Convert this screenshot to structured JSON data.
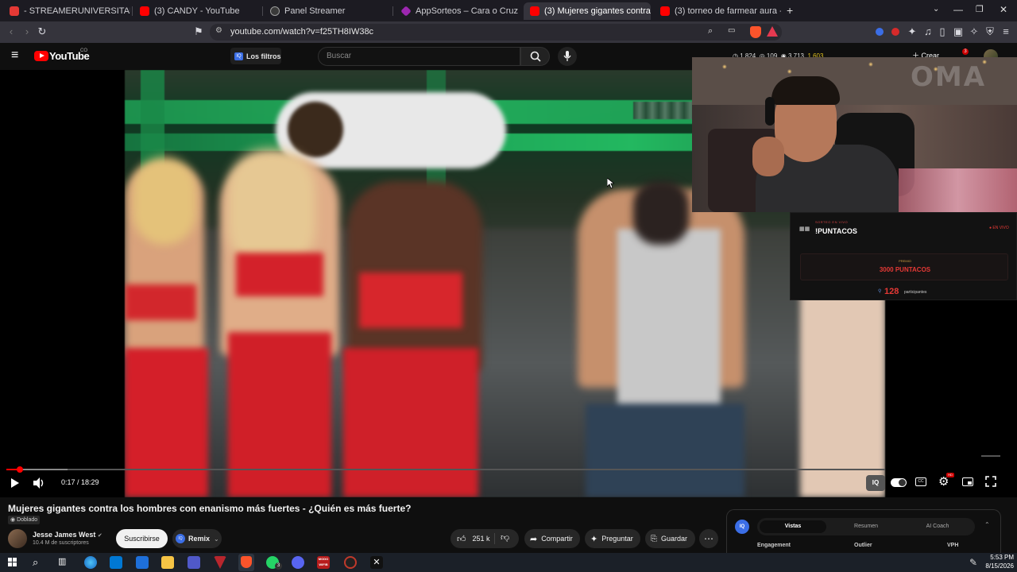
{
  "browser": {
    "tabs": [
      {
        "title": "- STREAMERUNIVERSITARIO - CANJE",
        "color": "#e53935"
      },
      {
        "title": "(3) CANDY - YouTube",
        "color": "#ff0000"
      },
      {
        "title": "Panel Streamer",
        "color": "#9e9e9e"
      },
      {
        "title": "AppSorteos – Cara o Cruz - Tirar una",
        "color": "#9c27b0"
      },
      {
        "title": "(3) Mujeres gigantes contra los h",
        "color": "#ff0000"
      },
      {
        "title": "(3) torneo de farmear aura - YouTube",
        "color": "#ff0000"
      }
    ],
    "new_tab": "+",
    "url": "youtube.com/watch?v=f25TH8IW38c"
  },
  "youtube": {
    "logo": "YouTube",
    "country": "CO",
    "filters_label": "Los filtros",
    "search_placeholder": "Buscar",
    "stats": [
      "1.824",
      "109",
      "3.713",
      "1.603"
    ],
    "create_label": "Crear",
    "notif_count": "3"
  },
  "player": {
    "time": "0:17 / 18:29",
    "progress": 0.015,
    "buffered": 0.07,
    "hd_badge": "HD"
  },
  "raffle": {
    "header": "SORTEO EN VIVO",
    "title": "!PUNTACOS",
    "live": "EN VIVO",
    "prize_label": "PREMIO",
    "prize": "3000 PUNTACOS",
    "count": "128",
    "count_label": "participantes"
  },
  "webcam": {
    "overlay_text": "OMA"
  },
  "video": {
    "title": "Mujeres gigantes contra los hombres con enanismo más fuertes - ¿Quién es más fuerte?",
    "dubbed": "Doblado",
    "channel": "Jesse James West",
    "subscribers": "10.4 M de suscriptores",
    "subscribe": "Suscribirse",
    "remix": "Remix",
    "likes": "251 k",
    "share": "Compartir",
    "ask": "Preguntar",
    "save": "Guardar"
  },
  "side_panel": {
    "tabs": [
      "Vistas",
      "Resumen",
      "AI Coach"
    ],
    "cols": [
      "Engagement",
      "Outlier",
      "VPH"
    ]
  },
  "taskbar": {
    "time": "5:53 PM",
    "date": "8/15/2026",
    "whatsapp_badge": "3",
    "app_label": "MODO\nWIFIB"
  },
  "colors": {
    "accent": "#ff0000",
    "youtube_bg": "#0f0f0f",
    "raffle_red": "#e53935"
  }
}
